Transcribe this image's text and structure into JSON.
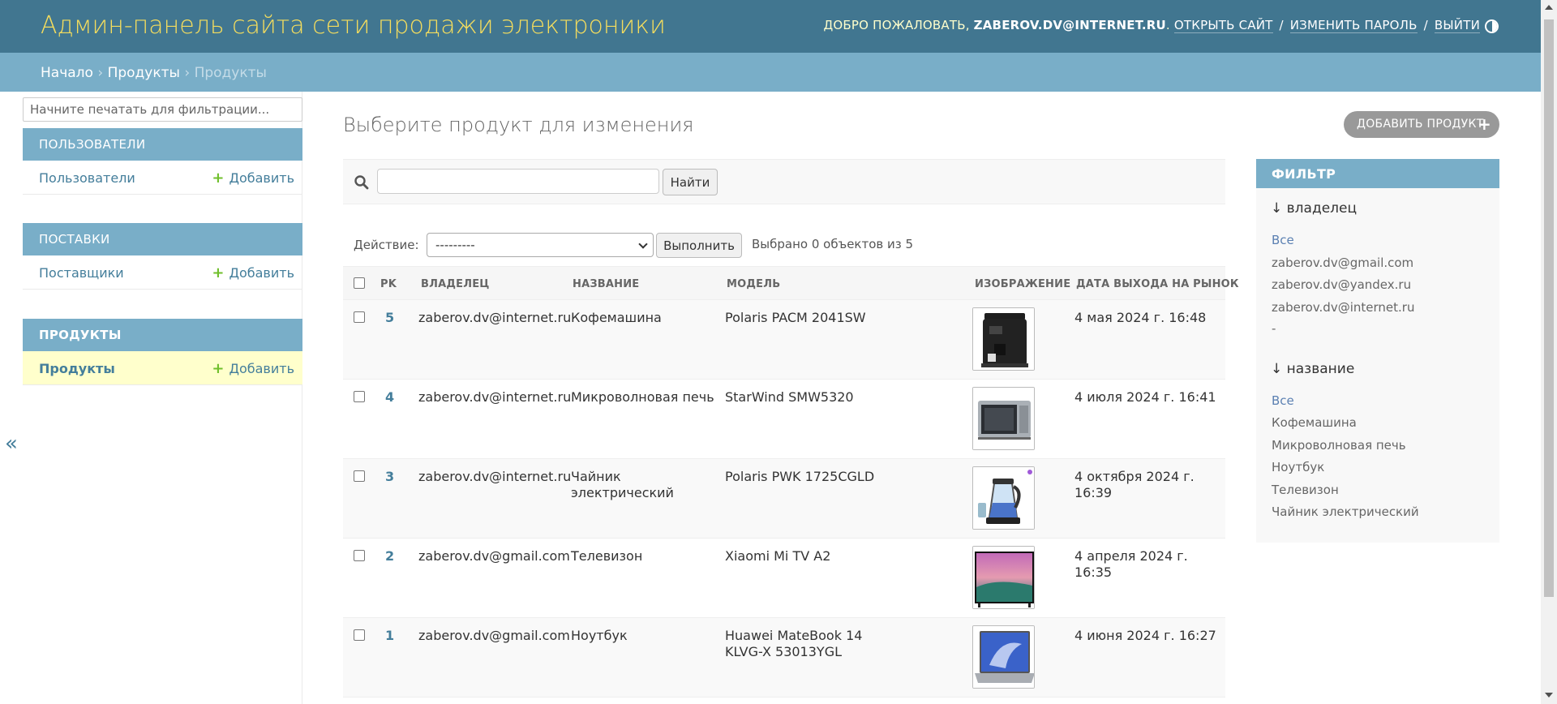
{
  "header": {
    "site_title": "Админ-панель сайта сети продажи электроники",
    "welcome": "Добро пожаловать,",
    "username": "zaberov.dv@internet.ru",
    "view_site": "Открыть сайт",
    "change_password": "Изменить пароль",
    "logout": "Выйти",
    "separator": "/"
  },
  "breadcrumbs": {
    "home": "Начало",
    "app": "Продукты",
    "current": "Продукты",
    "sep": "›"
  },
  "sidebar": {
    "filter_placeholder": "Начните печатать для фильтрации...",
    "add_label": "Добавить",
    "collapse": "«",
    "modules": [
      {
        "caption": "Пользователи",
        "link": "Пользователи"
      },
      {
        "caption": "Поставки",
        "link": "Поставщики"
      },
      {
        "caption": "Продукты",
        "link": "Продукты"
      }
    ]
  },
  "content": {
    "title": "Выберите продукт для изменения",
    "add_button": "Добавить продукт",
    "search_button": "Найти",
    "action_label": "Действие:",
    "action_selected": "---------",
    "action_go": "Выполнить",
    "action_counter": "Выбрано 0 объектов из 5"
  },
  "table": {
    "columns": [
      "PK",
      "Владелец",
      "Название",
      "Модель",
      "Изображение",
      "Дата выхода на рынок"
    ],
    "rows": [
      {
        "pk": "5",
        "owner": "zaberov.dv@internet.ru",
        "name": "Кофемашина",
        "model": "Polaris PACM 2041SW",
        "image": "coffee-machine-image",
        "date": "4 мая 2024 г. 16:48"
      },
      {
        "pk": "4",
        "owner": "zaberov.dv@internet.ru",
        "name": "Микроволновая печь",
        "model": "StarWind SMW5320",
        "image": "microwave-image",
        "date": "4 июля 2024 г. 16:41"
      },
      {
        "pk": "3",
        "owner": "zaberov.dv@internet.ru",
        "name": "Чайник электрический",
        "model": "Polaris PWK 1725CGLD",
        "image": "kettle-image",
        "date": "4 октября 2024 г. 16:39"
      },
      {
        "pk": "2",
        "owner": "zaberov.dv@gmail.com",
        "name": "Телевизон",
        "model": "Xiaomi Mi TV A2",
        "image": "tv-image",
        "date": "4 апреля 2024 г. 16:35"
      },
      {
        "pk": "1",
        "owner": "zaberov.dv@gmail.com",
        "name": "Ноутбук",
        "model": "Huawei MateBook 14 KLVG-X 53013YGL",
        "image": "laptop-image",
        "date": "4 июня 2024 г. 16:27"
      }
    ]
  },
  "filter": {
    "title": "Фильтр",
    "groups": [
      {
        "heading": "↓ владелец",
        "items": [
          "Все",
          "zaberov.dv@gmail.com",
          "zaberov.dv@yandex.ru",
          "zaberov.dv@internet.ru",
          "-"
        ]
      },
      {
        "heading": "↓ название",
        "items": [
          "Все",
          "Кофемашина",
          "Микроволновая печь",
          "Ноутбук",
          "Телевизон",
          "Чайник электрический"
        ]
      }
    ]
  },
  "colors": {
    "header_bg": "#417690",
    "breadcrumbs_bg": "#79aec8",
    "brand_text": "#f5dd5d",
    "link": "#447e9b",
    "add_plus": "#70bf2b",
    "current_row": "#ffffcc"
  }
}
